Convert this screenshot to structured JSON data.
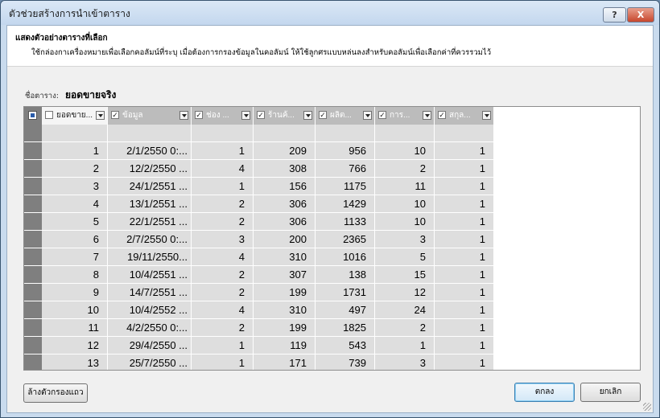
{
  "window": {
    "title": "ตัวช่วยสร้างการนำเข้าตาราง",
    "help_label": "?",
    "close_label": "X"
  },
  "header": {
    "title": "แสดงตัวอย่างตารางที่เลือก",
    "description": "ใช้กล่องกาเครื่องหมายเพื่อเลือกคอลัมน์ที่ระบุ เมื่อต้องการกรองข้อมูลในคอลัมน์ ให้ใช้ลูกศรแบบหล่นลงสำหรับคอลัมน์เพื่อเลือกค่าที่ควรรวมไว้"
  },
  "table_name": {
    "label": "ชื่อตาราง:",
    "value": "ยอดขายจริง"
  },
  "grid": {
    "columns": [
      {
        "label": "ยอดขาย...",
        "checked": false
      },
      {
        "label": "ข้อมูล",
        "checked": true
      },
      {
        "label": "ช่อง ...",
        "checked": true
      },
      {
        "label": "ร้านค้...",
        "checked": true
      },
      {
        "label": "ผลิต...",
        "checked": true
      },
      {
        "label": "การ...",
        "checked": true
      },
      {
        "label": "สกุล...",
        "checked": true
      }
    ],
    "rows": [
      [
        "1",
        "2/1/2550 0:...",
        "1",
        "209",
        "956",
        "10",
        "1"
      ],
      [
        "2",
        "12/2/2550 ...",
        "4",
        "308",
        "766",
        "2",
        "1"
      ],
      [
        "3",
        "24/1/2551 ...",
        "1",
        "156",
        "1175",
        "11",
        "1"
      ],
      [
        "4",
        "13/1/2551 ...",
        "2",
        "306",
        "1429",
        "10",
        "1"
      ],
      [
        "5",
        "22/1/2551 ...",
        "2",
        "306",
        "1133",
        "10",
        "1"
      ],
      [
        "6",
        "2/7/2550 0:...",
        "3",
        "200",
        "2365",
        "3",
        "1"
      ],
      [
        "7",
        "19/11/2550...",
        "4",
        "310",
        "1016",
        "5",
        "1"
      ],
      [
        "8",
        "10/4/2551 ...",
        "2",
        "307",
        "138",
        "15",
        "1"
      ],
      [
        "9",
        "14/7/2551 ...",
        "2",
        "199",
        "1731",
        "12",
        "1"
      ],
      [
        "10",
        "10/4/2552 ...",
        "4",
        "310",
        "497",
        "24",
        "1"
      ],
      [
        "11",
        "4/2/2550 0:...",
        "2",
        "199",
        "1825",
        "2",
        "1"
      ],
      [
        "12",
        "29/4/2550 ...",
        "1",
        "119",
        "543",
        "1",
        "1"
      ],
      [
        "13",
        "25/7/2550 ...",
        "1",
        "171",
        "739",
        "3",
        "1"
      ]
    ]
  },
  "buttons": {
    "clear_filters": "ล้างตัวกรองแถว",
    "ok": "ตกลง",
    "cancel": "ยกเลิก"
  }
}
